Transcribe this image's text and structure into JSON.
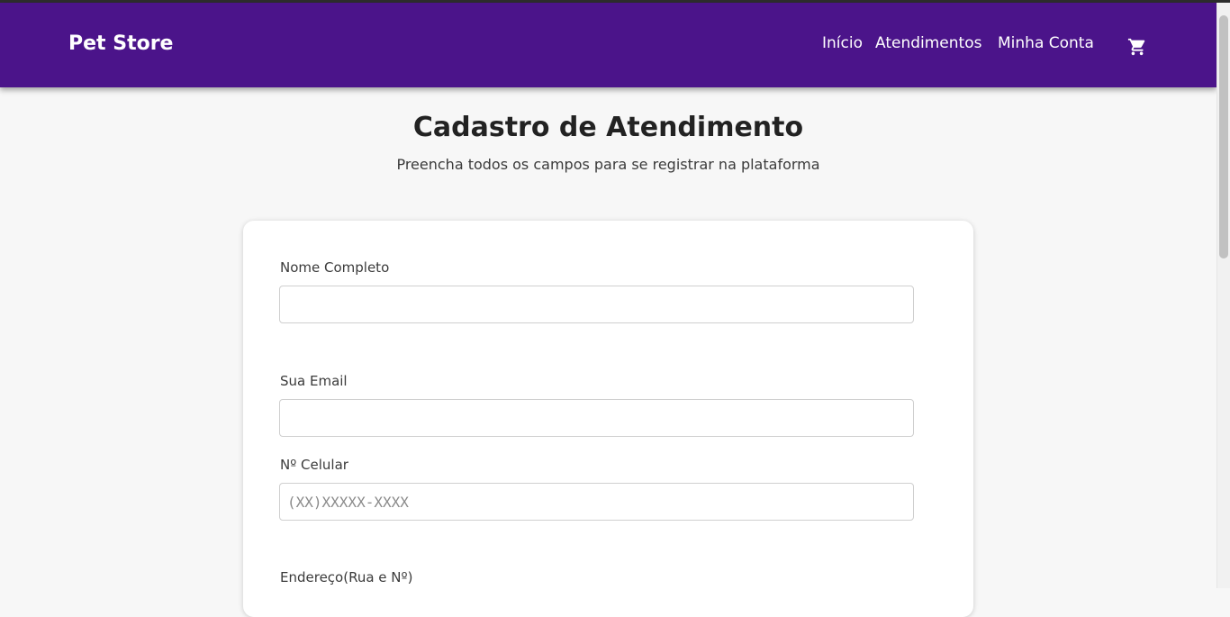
{
  "navbar": {
    "brand": "Pet Store",
    "links": {
      "home": "Início",
      "services": "Atendimentos",
      "account": "Minha Conta"
    },
    "cart_icon": "shopping-cart-icon",
    "background_color": "#4b148a"
  },
  "header": {
    "title": "Cadastro de Atendimento",
    "subtitle": "Preencha todos os campos para se registrar na plataforma"
  },
  "form": {
    "name": {
      "label": "Nome Completo",
      "value": "",
      "placeholder": ""
    },
    "email": {
      "label": "Sua Email",
      "value": "",
      "placeholder": ""
    },
    "phone": {
      "label": "Nº Celular",
      "value": "",
      "placeholder": "(XX)XXXXX-XXXX"
    },
    "address": {
      "label": "Endereço(Rua e Nº)"
    }
  }
}
